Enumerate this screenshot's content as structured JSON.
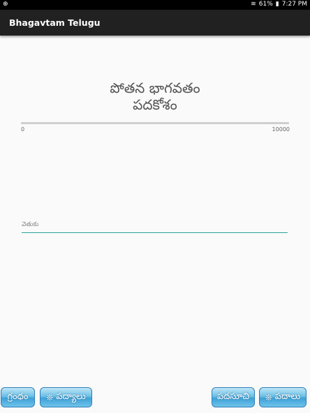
{
  "status": {
    "battery": "61%",
    "time": "7:27 PM"
  },
  "app": {
    "title": "Bhagavtam Telugu"
  },
  "heading": {
    "line1": "పోతన భాగవతం",
    "line2": "పదకోశం"
  },
  "slider": {
    "min_label": "0",
    "max_label": "10000",
    "value": 0
  },
  "search": {
    "placeholder": "వెతుకు",
    "value": ""
  },
  "buttons": {
    "grantham": "గ్రంధం",
    "padyalu": "పద్యాలు",
    "padasuchi": "పదసూచి",
    "padalu": "పదాలు"
  }
}
